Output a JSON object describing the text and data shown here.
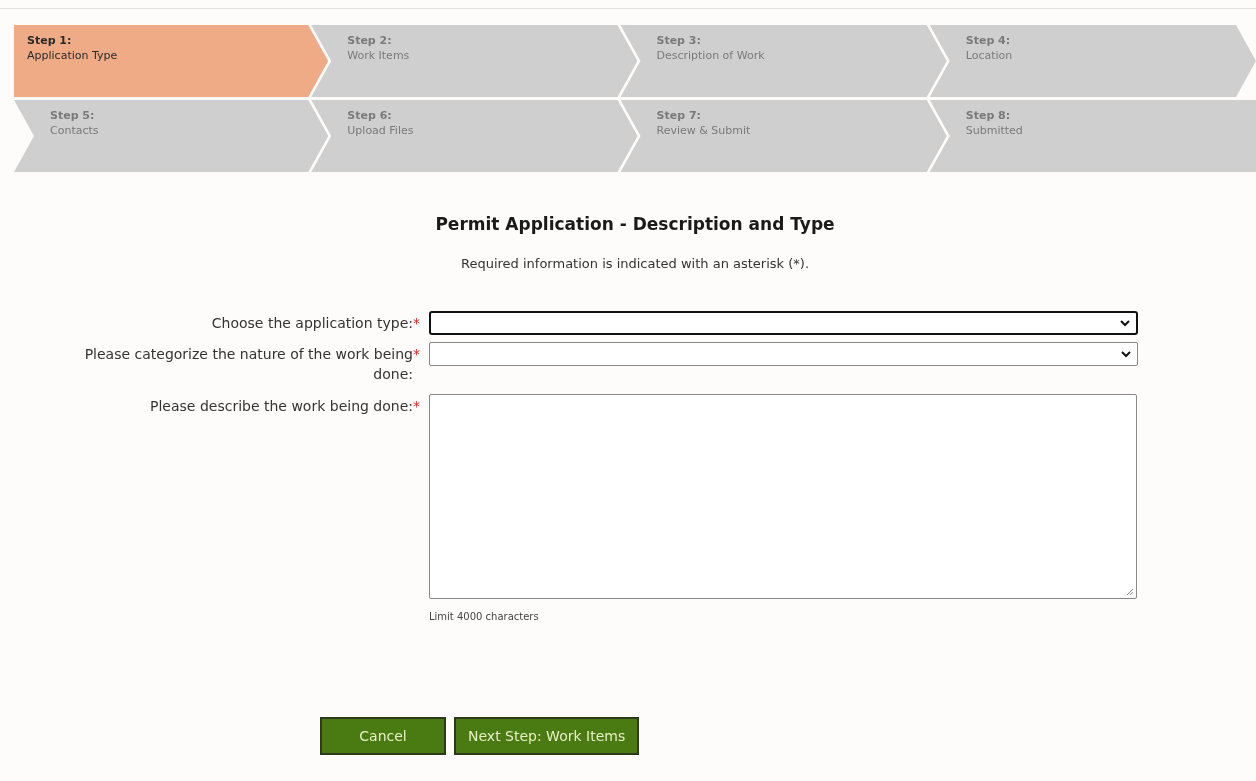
{
  "steps": [
    {
      "label": "Step 1:",
      "title": "Application Type",
      "selected": true
    },
    {
      "label": "Step 2:",
      "title": "Work Items",
      "selected": false
    },
    {
      "label": "Step 3:",
      "title": "Description of Work",
      "selected": false
    },
    {
      "label": "Step 4:",
      "title": "Location",
      "selected": false
    },
    {
      "label": "Step 5:",
      "title": "Contacts",
      "selected": false
    },
    {
      "label": "Step 6:",
      "title": "Upload Files",
      "selected": false
    },
    {
      "label": "Step 7:",
      "title": "Review & Submit",
      "selected": false
    },
    {
      "label": "Step 8:",
      "title": "Submitted",
      "selected": false
    }
  ],
  "form": {
    "heading": "Permit Application - Description and Type",
    "note": "Required information is indicated with an asterisk (*).",
    "fields": [
      {
        "kind": "select",
        "label": "Choose the application type:",
        "required_mark": "*",
        "focused": true
      },
      {
        "kind": "select",
        "label": "Please categorize the nature of the work being done:",
        "required_mark": "*",
        "focused": false
      },
      {
        "kind": "textarea",
        "label": "Please describe the work being done:",
        "required_mark": "*",
        "focused": false,
        "hint": "Limit 4000 characters"
      }
    ]
  },
  "buttons": [
    "Cancel",
    "Next Step: Work Items"
  ]
}
